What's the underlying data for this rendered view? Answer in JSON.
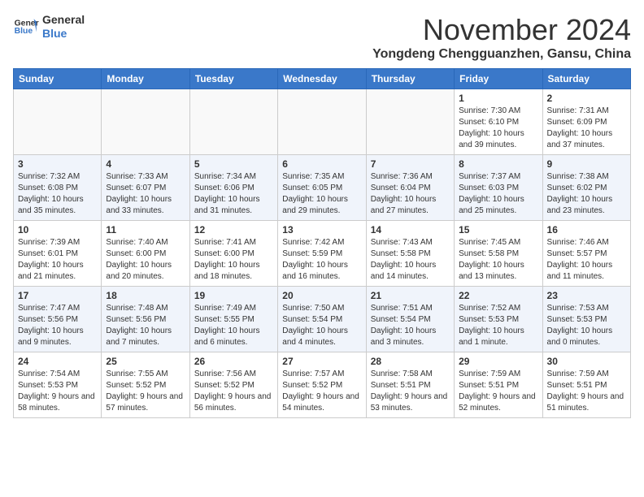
{
  "logo": {
    "line1": "General",
    "line2": "Blue"
  },
  "title": "November 2024",
  "location": "Yongdeng Chengguanzhen, Gansu, China",
  "weekdays": [
    "Sunday",
    "Monday",
    "Tuesday",
    "Wednesday",
    "Thursday",
    "Friday",
    "Saturday"
  ],
  "weeks": [
    [
      {
        "day": "",
        "info": ""
      },
      {
        "day": "",
        "info": ""
      },
      {
        "day": "",
        "info": ""
      },
      {
        "day": "",
        "info": ""
      },
      {
        "day": "",
        "info": ""
      },
      {
        "day": "1",
        "info": "Sunrise: 7:30 AM\nSunset: 6:10 PM\nDaylight: 10 hours and 39 minutes."
      },
      {
        "day": "2",
        "info": "Sunrise: 7:31 AM\nSunset: 6:09 PM\nDaylight: 10 hours and 37 minutes."
      }
    ],
    [
      {
        "day": "3",
        "info": "Sunrise: 7:32 AM\nSunset: 6:08 PM\nDaylight: 10 hours and 35 minutes."
      },
      {
        "day": "4",
        "info": "Sunrise: 7:33 AM\nSunset: 6:07 PM\nDaylight: 10 hours and 33 minutes."
      },
      {
        "day": "5",
        "info": "Sunrise: 7:34 AM\nSunset: 6:06 PM\nDaylight: 10 hours and 31 minutes."
      },
      {
        "day": "6",
        "info": "Sunrise: 7:35 AM\nSunset: 6:05 PM\nDaylight: 10 hours and 29 minutes."
      },
      {
        "day": "7",
        "info": "Sunrise: 7:36 AM\nSunset: 6:04 PM\nDaylight: 10 hours and 27 minutes."
      },
      {
        "day": "8",
        "info": "Sunrise: 7:37 AM\nSunset: 6:03 PM\nDaylight: 10 hours and 25 minutes."
      },
      {
        "day": "9",
        "info": "Sunrise: 7:38 AM\nSunset: 6:02 PM\nDaylight: 10 hours and 23 minutes."
      }
    ],
    [
      {
        "day": "10",
        "info": "Sunrise: 7:39 AM\nSunset: 6:01 PM\nDaylight: 10 hours and 21 minutes."
      },
      {
        "day": "11",
        "info": "Sunrise: 7:40 AM\nSunset: 6:00 PM\nDaylight: 10 hours and 20 minutes."
      },
      {
        "day": "12",
        "info": "Sunrise: 7:41 AM\nSunset: 6:00 PM\nDaylight: 10 hours and 18 minutes."
      },
      {
        "day": "13",
        "info": "Sunrise: 7:42 AM\nSunset: 5:59 PM\nDaylight: 10 hours and 16 minutes."
      },
      {
        "day": "14",
        "info": "Sunrise: 7:43 AM\nSunset: 5:58 PM\nDaylight: 10 hours and 14 minutes."
      },
      {
        "day": "15",
        "info": "Sunrise: 7:45 AM\nSunset: 5:58 PM\nDaylight: 10 hours and 13 minutes."
      },
      {
        "day": "16",
        "info": "Sunrise: 7:46 AM\nSunset: 5:57 PM\nDaylight: 10 hours and 11 minutes."
      }
    ],
    [
      {
        "day": "17",
        "info": "Sunrise: 7:47 AM\nSunset: 5:56 PM\nDaylight: 10 hours and 9 minutes."
      },
      {
        "day": "18",
        "info": "Sunrise: 7:48 AM\nSunset: 5:56 PM\nDaylight: 10 hours and 7 minutes."
      },
      {
        "day": "19",
        "info": "Sunrise: 7:49 AM\nSunset: 5:55 PM\nDaylight: 10 hours and 6 minutes."
      },
      {
        "day": "20",
        "info": "Sunrise: 7:50 AM\nSunset: 5:54 PM\nDaylight: 10 hours and 4 minutes."
      },
      {
        "day": "21",
        "info": "Sunrise: 7:51 AM\nSunset: 5:54 PM\nDaylight: 10 hours and 3 minutes."
      },
      {
        "day": "22",
        "info": "Sunrise: 7:52 AM\nSunset: 5:53 PM\nDaylight: 10 hours and 1 minute."
      },
      {
        "day": "23",
        "info": "Sunrise: 7:53 AM\nSunset: 5:53 PM\nDaylight: 10 hours and 0 minutes."
      }
    ],
    [
      {
        "day": "24",
        "info": "Sunrise: 7:54 AM\nSunset: 5:53 PM\nDaylight: 9 hours and 58 minutes."
      },
      {
        "day": "25",
        "info": "Sunrise: 7:55 AM\nSunset: 5:52 PM\nDaylight: 9 hours and 57 minutes."
      },
      {
        "day": "26",
        "info": "Sunrise: 7:56 AM\nSunset: 5:52 PM\nDaylight: 9 hours and 56 minutes."
      },
      {
        "day": "27",
        "info": "Sunrise: 7:57 AM\nSunset: 5:52 PM\nDaylight: 9 hours and 54 minutes."
      },
      {
        "day": "28",
        "info": "Sunrise: 7:58 AM\nSunset: 5:51 PM\nDaylight: 9 hours and 53 minutes."
      },
      {
        "day": "29",
        "info": "Sunrise: 7:59 AM\nSunset: 5:51 PM\nDaylight: 9 hours and 52 minutes."
      },
      {
        "day": "30",
        "info": "Sunrise: 7:59 AM\nSunset: 5:51 PM\nDaylight: 9 hours and 51 minutes."
      }
    ]
  ]
}
